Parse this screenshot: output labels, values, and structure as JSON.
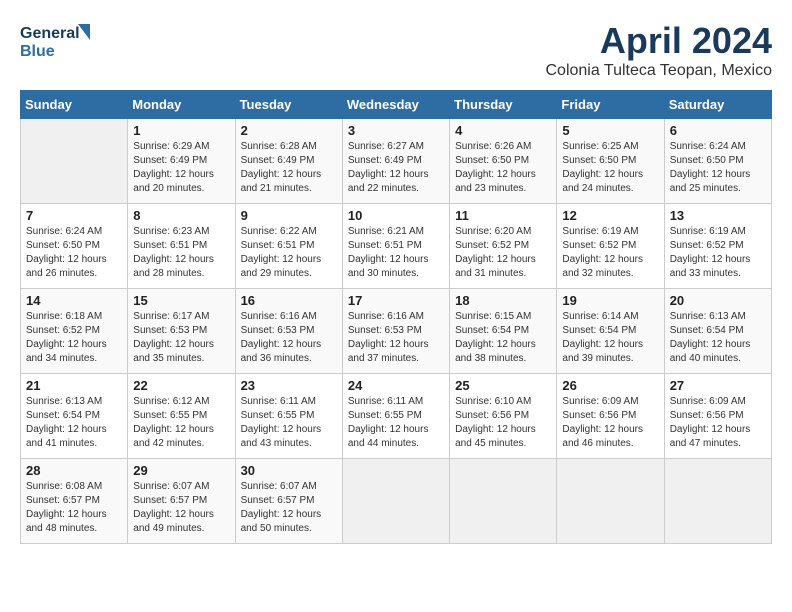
{
  "header": {
    "logo_line1": "General",
    "logo_line2": "Blue",
    "month_title": "April 2024",
    "subtitle": "Colonia Tulteca Teopan, Mexico"
  },
  "weekdays": [
    "Sunday",
    "Monday",
    "Tuesday",
    "Wednesday",
    "Thursday",
    "Friday",
    "Saturday"
  ],
  "weeks": [
    [
      {
        "day": "",
        "info": ""
      },
      {
        "day": "1",
        "info": "Sunrise: 6:29 AM\nSunset: 6:49 PM\nDaylight: 12 hours\nand 20 minutes."
      },
      {
        "day": "2",
        "info": "Sunrise: 6:28 AM\nSunset: 6:49 PM\nDaylight: 12 hours\nand 21 minutes."
      },
      {
        "day": "3",
        "info": "Sunrise: 6:27 AM\nSunset: 6:49 PM\nDaylight: 12 hours\nand 22 minutes."
      },
      {
        "day": "4",
        "info": "Sunrise: 6:26 AM\nSunset: 6:50 PM\nDaylight: 12 hours\nand 23 minutes."
      },
      {
        "day": "5",
        "info": "Sunrise: 6:25 AM\nSunset: 6:50 PM\nDaylight: 12 hours\nand 24 minutes."
      },
      {
        "day": "6",
        "info": "Sunrise: 6:24 AM\nSunset: 6:50 PM\nDaylight: 12 hours\nand 25 minutes."
      }
    ],
    [
      {
        "day": "7",
        "info": "Sunrise: 6:24 AM\nSunset: 6:50 PM\nDaylight: 12 hours\nand 26 minutes."
      },
      {
        "day": "8",
        "info": "Sunrise: 6:23 AM\nSunset: 6:51 PM\nDaylight: 12 hours\nand 28 minutes."
      },
      {
        "day": "9",
        "info": "Sunrise: 6:22 AM\nSunset: 6:51 PM\nDaylight: 12 hours\nand 29 minutes."
      },
      {
        "day": "10",
        "info": "Sunrise: 6:21 AM\nSunset: 6:51 PM\nDaylight: 12 hours\nand 30 minutes."
      },
      {
        "day": "11",
        "info": "Sunrise: 6:20 AM\nSunset: 6:52 PM\nDaylight: 12 hours\nand 31 minutes."
      },
      {
        "day": "12",
        "info": "Sunrise: 6:19 AM\nSunset: 6:52 PM\nDaylight: 12 hours\nand 32 minutes."
      },
      {
        "day": "13",
        "info": "Sunrise: 6:19 AM\nSunset: 6:52 PM\nDaylight: 12 hours\nand 33 minutes."
      }
    ],
    [
      {
        "day": "14",
        "info": "Sunrise: 6:18 AM\nSunset: 6:52 PM\nDaylight: 12 hours\nand 34 minutes."
      },
      {
        "day": "15",
        "info": "Sunrise: 6:17 AM\nSunset: 6:53 PM\nDaylight: 12 hours\nand 35 minutes."
      },
      {
        "day": "16",
        "info": "Sunrise: 6:16 AM\nSunset: 6:53 PM\nDaylight: 12 hours\nand 36 minutes."
      },
      {
        "day": "17",
        "info": "Sunrise: 6:16 AM\nSunset: 6:53 PM\nDaylight: 12 hours\nand 37 minutes."
      },
      {
        "day": "18",
        "info": "Sunrise: 6:15 AM\nSunset: 6:54 PM\nDaylight: 12 hours\nand 38 minutes."
      },
      {
        "day": "19",
        "info": "Sunrise: 6:14 AM\nSunset: 6:54 PM\nDaylight: 12 hours\nand 39 minutes."
      },
      {
        "day": "20",
        "info": "Sunrise: 6:13 AM\nSunset: 6:54 PM\nDaylight: 12 hours\nand 40 minutes."
      }
    ],
    [
      {
        "day": "21",
        "info": "Sunrise: 6:13 AM\nSunset: 6:54 PM\nDaylight: 12 hours\nand 41 minutes."
      },
      {
        "day": "22",
        "info": "Sunrise: 6:12 AM\nSunset: 6:55 PM\nDaylight: 12 hours\nand 42 minutes."
      },
      {
        "day": "23",
        "info": "Sunrise: 6:11 AM\nSunset: 6:55 PM\nDaylight: 12 hours\nand 43 minutes."
      },
      {
        "day": "24",
        "info": "Sunrise: 6:11 AM\nSunset: 6:55 PM\nDaylight: 12 hours\nand 44 minutes."
      },
      {
        "day": "25",
        "info": "Sunrise: 6:10 AM\nSunset: 6:56 PM\nDaylight: 12 hours\nand 45 minutes."
      },
      {
        "day": "26",
        "info": "Sunrise: 6:09 AM\nSunset: 6:56 PM\nDaylight: 12 hours\nand 46 minutes."
      },
      {
        "day": "27",
        "info": "Sunrise: 6:09 AM\nSunset: 6:56 PM\nDaylight: 12 hours\nand 47 minutes."
      }
    ],
    [
      {
        "day": "28",
        "info": "Sunrise: 6:08 AM\nSunset: 6:57 PM\nDaylight: 12 hours\nand 48 minutes."
      },
      {
        "day": "29",
        "info": "Sunrise: 6:07 AM\nSunset: 6:57 PM\nDaylight: 12 hours\nand 49 minutes."
      },
      {
        "day": "30",
        "info": "Sunrise: 6:07 AM\nSunset: 6:57 PM\nDaylight: 12 hours\nand 50 minutes."
      },
      {
        "day": "",
        "info": ""
      },
      {
        "day": "",
        "info": ""
      },
      {
        "day": "",
        "info": ""
      },
      {
        "day": "",
        "info": ""
      }
    ]
  ]
}
